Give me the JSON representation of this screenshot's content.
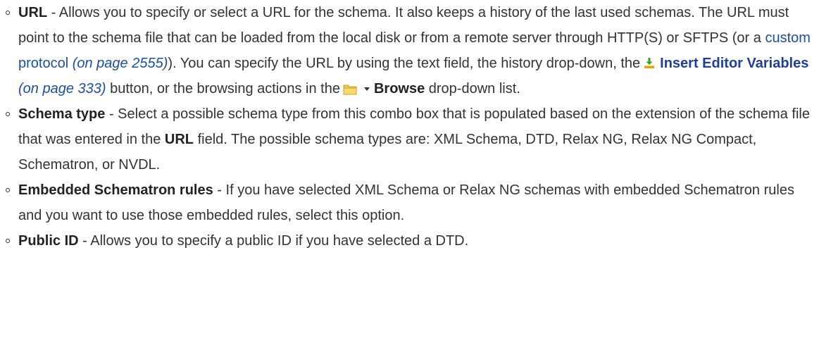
{
  "items": [
    {
      "term": "URL",
      "sep": " - ",
      "text_1": "Allows you to specify or select a URL for the schema. It also keeps a history of the last used schemas. The URL must point to the schema file that can be loaded from the local disk or from a remote server through HTTP(S) or SFTPS (or a ",
      "link_custom_protocol": "custom protocol",
      "link_custom_protocol_page": "(on page 2555)",
      "text_2": "). You can specify the URL by using the text field, the history drop-down, the",
      "link_insert_editor_variables": "Insert Editor Variables",
      "link_insert_editor_variables_page": "(on page 333)",
      "text_3": " button, or the browsing actions in the",
      "browse_label": "Browse",
      "text_4": " drop-down list."
    },
    {
      "term": "Schema type",
      "sep": " - ",
      "text_1": "Select a possible schema type from this combo box that is populated based on the extension of the schema file that was entered in the ",
      "url_ref": "URL",
      "text_2": " field. The possible schema types are: XML Schema, DTD, Relax NG, Relax NG Compact, Schematron, or NVDL."
    },
    {
      "term": "Embedded Schematron rules",
      "sep": " - ",
      "text_1": "If you have selected XML Schema or Relax NG schemas with embedded Schematron rules and you want to use those embedded rules, select this option."
    },
    {
      "term": "Public ID",
      "sep": " - ",
      "text_1": "Allows you to specify a public ID if you have selected a DTD."
    }
  ],
  "icons": {
    "insert_editor_variables": "insert-variables-icon",
    "browse": "folder-icon",
    "browse_dropdown": "chevron-down-icon"
  },
  "colors": {
    "text": "#333333",
    "link": "#1a4fa8",
    "icon_folder": "#f2c94c",
    "icon_variables_arrow": "#3a9d23",
    "icon_variables_base": "#e0a800"
  }
}
